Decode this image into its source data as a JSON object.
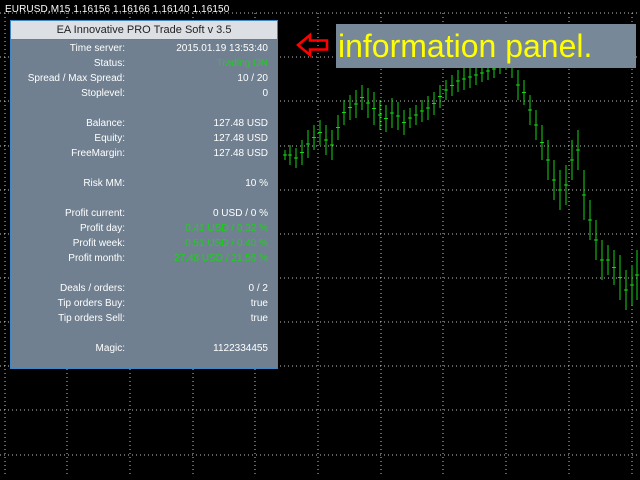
{
  "chart": {
    "symbol_info": "EURUSD,M15  1.16156 1.16166 1.16140 1.16150",
    "colors": {
      "background": "#000000",
      "grid": "#ffffff",
      "candle": "#19d219"
    }
  },
  "panel": {
    "title": "EA Innovative PRO Trade Soft v 3.5",
    "rows": [
      {
        "label": "Time server:",
        "value": "2015.01.19 13:53:40",
        "color": "white"
      },
      {
        "label": "Status:",
        "value": "Trading ON",
        "color": "green"
      },
      {
        "label": "Spread  /  Max Spread:",
        "value": "10  /  20",
        "color": "white"
      },
      {
        "label": "Stoplevel:",
        "value": "0",
        "color": "white"
      },
      {
        "label": "Balance:",
        "value": "127.48  USD",
        "color": "white"
      },
      {
        "label": "Equity:",
        "value": "127.48  USD",
        "color": "white"
      },
      {
        "label": "FreeMargin:",
        "value": "127.48  USD",
        "color": "white"
      },
      {
        "label": "Risk MM:",
        "value": "10 %",
        "color": "white"
      },
      {
        "label": "Profit current:",
        "value": "0  USD  /  0 %",
        "color": "white"
      },
      {
        "label": "Profit day:",
        "value": "0.41  USD  /  0.32 %",
        "color": "green"
      },
      {
        "label": "Profit week:",
        "value": "0.51  USD  /  0.40 %",
        "color": "green"
      },
      {
        "label": "Profit month:",
        "value": "27.48  USD  /  21.56 %",
        "color": "green"
      },
      {
        "label": "Deals / orders:",
        "value": "0  /  2",
        "color": "white"
      },
      {
        "label": "Tip orders Buy:",
        "value": "true",
        "color": "white"
      },
      {
        "label": "Tip orders Sell:",
        "value": "true",
        "color": "white"
      },
      {
        "label": "Magic:",
        "value": "1122334455",
        "color": "white"
      }
    ]
  },
  "banner": {
    "text": "information panel.",
    "text_color": "#ffff00",
    "background": "#778899",
    "arrow_icon": "left-arrow-icon",
    "arrow_color": "#ff0000"
  }
}
